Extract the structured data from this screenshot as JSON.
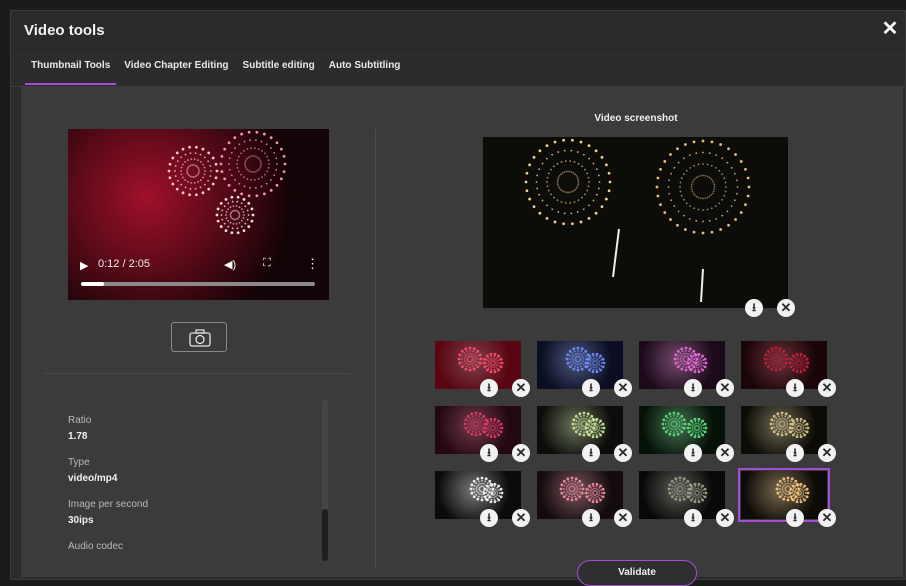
{
  "window": {
    "title": "Video tools"
  },
  "tabs": [
    {
      "label": "Thumbnail Tools",
      "active": true
    },
    {
      "label": "Video Chapter Editing",
      "active": false
    },
    {
      "label": "Subtitle editing",
      "active": false
    },
    {
      "label": "Auto Subtitling",
      "active": false
    }
  ],
  "player": {
    "time": "0:12 / 2:05",
    "progress_fraction": 0.1
  },
  "properties": [
    {
      "label": "Ratio",
      "value": "1.78"
    },
    {
      "label": "Type",
      "value": "video/mp4"
    },
    {
      "label": "Image per second",
      "value": "30ips"
    },
    {
      "label": "Audio codec",
      "value": ""
    }
  ],
  "screenshot": {
    "title": "Video screenshot"
  },
  "thumbnails": [
    {
      "theme": "red",
      "selected": false
    },
    {
      "theme": "blue",
      "selected": false
    },
    {
      "theme": "pink",
      "selected": false
    },
    {
      "theme": "crimson",
      "selected": false
    },
    {
      "theme": "magenta-red",
      "selected": false
    },
    {
      "theme": "multicolor",
      "selected": false
    },
    {
      "theme": "green",
      "selected": false
    },
    {
      "theme": "gold-dim",
      "selected": false
    },
    {
      "theme": "white",
      "selected": false
    },
    {
      "theme": "pink-green",
      "selected": false
    },
    {
      "theme": "dark",
      "selected": false
    },
    {
      "theme": "gold",
      "selected": true
    }
  ],
  "icons": {
    "play": "play-icon",
    "volume": "volume-icon",
    "fullscreen": "fullscreen-icon",
    "more": "more-vertical-icon",
    "camera": "camera-icon",
    "download": "download-icon",
    "remove": "close-circle-icon"
  },
  "colors": {
    "accent": "#a64bd8",
    "panel": "#3b3b3b",
    "background": "#2c2c2c"
  },
  "actions": {
    "validate": "Validate"
  }
}
